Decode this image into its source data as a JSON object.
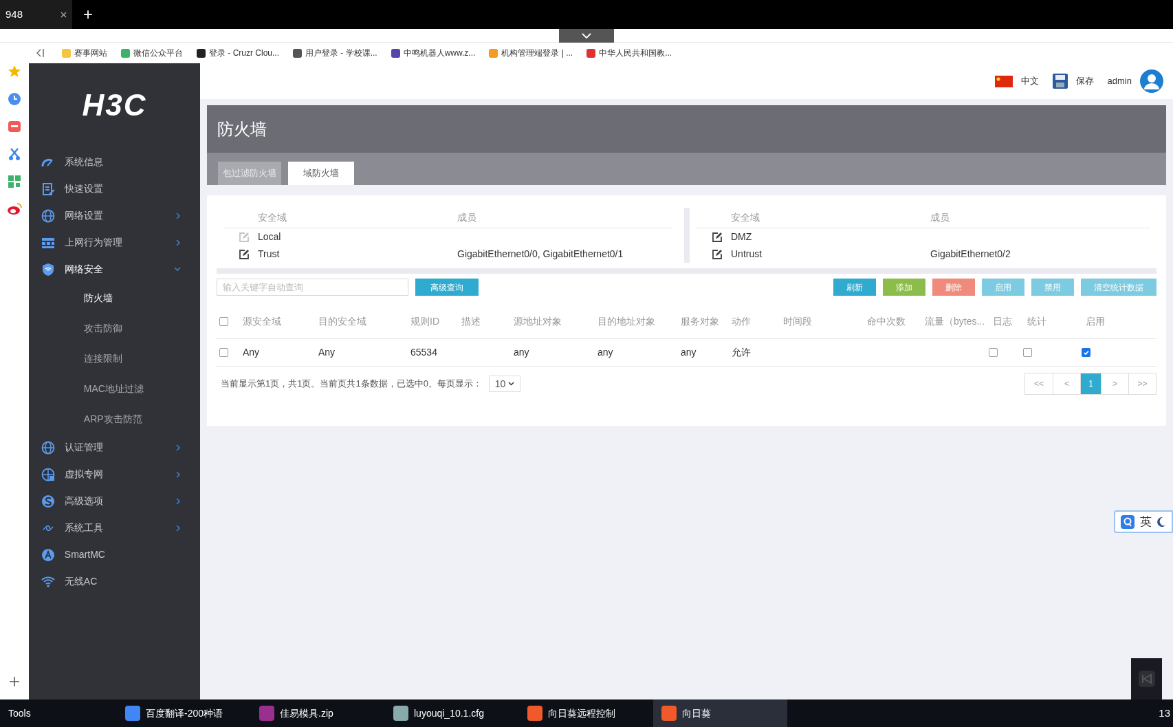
{
  "browser": {
    "tab_title": "948",
    "new_tab": "+",
    "bookmarks": [
      "赛事网站",
      "微信公众平台",
      "登录 - Cruzr Clou...",
      "用户登录 - 学校课...",
      "中鸣机器人www.z...",
      "机构管理端登录 | ...",
      "中华人民共和国教..."
    ]
  },
  "sidebar": {
    "logo": "H3C",
    "items": [
      {
        "label": "系统信息",
        "expandable": false,
        "expanded": false
      },
      {
        "label": "快速设置",
        "expandable": false,
        "expanded": false
      },
      {
        "label": "网络设置",
        "expandable": true,
        "expanded": false
      },
      {
        "label": "上网行为管理",
        "expandable": true,
        "expanded": false
      },
      {
        "label": "网络安全",
        "expandable": true,
        "expanded": true,
        "children": [
          {
            "label": "防火墙",
            "selected": true
          },
          {
            "label": "攻击防御",
            "selected": false
          },
          {
            "label": "连接限制",
            "selected": false
          },
          {
            "label": "MAC地址过滤",
            "selected": false
          },
          {
            "label": "ARP攻击防范",
            "selected": false
          }
        ]
      },
      {
        "label": "认证管理",
        "expandable": true,
        "expanded": false
      },
      {
        "label": "虚拟专网",
        "expandable": true,
        "expanded": false
      },
      {
        "label": "高级选项",
        "expandable": true,
        "expanded": false
      },
      {
        "label": "系统工具",
        "expandable": true,
        "expanded": false
      },
      {
        "label": "SmartMC",
        "expandable": false,
        "expanded": false
      },
      {
        "label": "无线AC",
        "expandable": false,
        "expanded": false
      }
    ]
  },
  "header": {
    "language": "中文",
    "save": "保存",
    "user": "admin"
  },
  "page": {
    "title": "防火墙",
    "tabs": [
      {
        "label": "包过滤防火墙",
        "selected": false
      },
      {
        "label": "域防火墙",
        "selected": true
      }
    ]
  },
  "zones": [
    {
      "columns": [
        "安全域",
        "成员"
      ],
      "rows": [
        {
          "name": "Local",
          "members_text": null,
          "disabled": true
        },
        {
          "name": "Trust",
          "members_text": "GigabitEthernet0/0, GigabitEthernet0/1",
          "disabled": false
        }
      ]
    },
    {
      "columns": [
        "安全域",
        "成员"
      ],
      "rows": [
        {
          "name": "DMZ",
          "members_text": null,
          "disabled": false
        },
        {
          "name": "Untrust",
          "members_text": "GigabitEthernet0/2",
          "disabled": false
        }
      ]
    }
  ],
  "search": {
    "placeholder": "输入关键字自动查询",
    "advanced": "高级查询"
  },
  "actions": [
    {
      "label": "刷新",
      "color": "#2eabcf"
    },
    {
      "label": "添加",
      "color": "#8cbd4a"
    },
    {
      "label": "删除",
      "color": "#f08a7a"
    },
    {
      "label": "启用",
      "color": "#7ccbe0"
    },
    {
      "label": "禁用",
      "color": "#7ccbe0"
    },
    {
      "label": "清空统计数据",
      "color": "#7ccbe0"
    }
  ],
  "table": {
    "all_checked": false,
    "columns": [
      "源安全域",
      "目的安全域",
      "规则ID",
      "描述",
      "源地址对象",
      "目的地址对象",
      "服务对象",
      "动作",
      "时间段",
      "命中次数",
      "流量（bytes...",
      "日志",
      "统计",
      "启用"
    ],
    "rows": [
      {
        "selected": false,
        "src_zone": "Any",
        "dst_zone": "Any",
        "rule_id": "65534",
        "src_addr": "any",
        "dst_addr": "any",
        "service": "any",
        "action": "允许",
        "log": false,
        "stats": false,
        "enabled": true
      }
    ]
  },
  "pagination": {
    "info": "当前显示第1页，共1页。当前页共1条数据，已选中0。每页显示：",
    "page_size": "10",
    "pages": [
      {
        "label": "<<",
        "selected": false
      },
      {
        "label": "<",
        "selected": false
      },
      {
        "label": "1",
        "selected": true
      },
      {
        "label": ">",
        "selected": false
      },
      {
        "label": ">>",
        "selected": false
      }
    ]
  },
  "ime": {
    "label": "英"
  },
  "taskbar": {
    "items": [
      {
        "label": "Tools",
        "active": false
      },
      {
        "label": "百度翻译-200种语",
        "active": false
      },
      {
        "label": "佳易模具.zip",
        "active": false
      },
      {
        "label": "luyouqi_10.1.cfg",
        "active": false
      },
      {
        "label": "向日葵远程控制",
        "active": false
      },
      {
        "label": "向日葵",
        "active": true
      }
    ],
    "clock": "13"
  }
}
